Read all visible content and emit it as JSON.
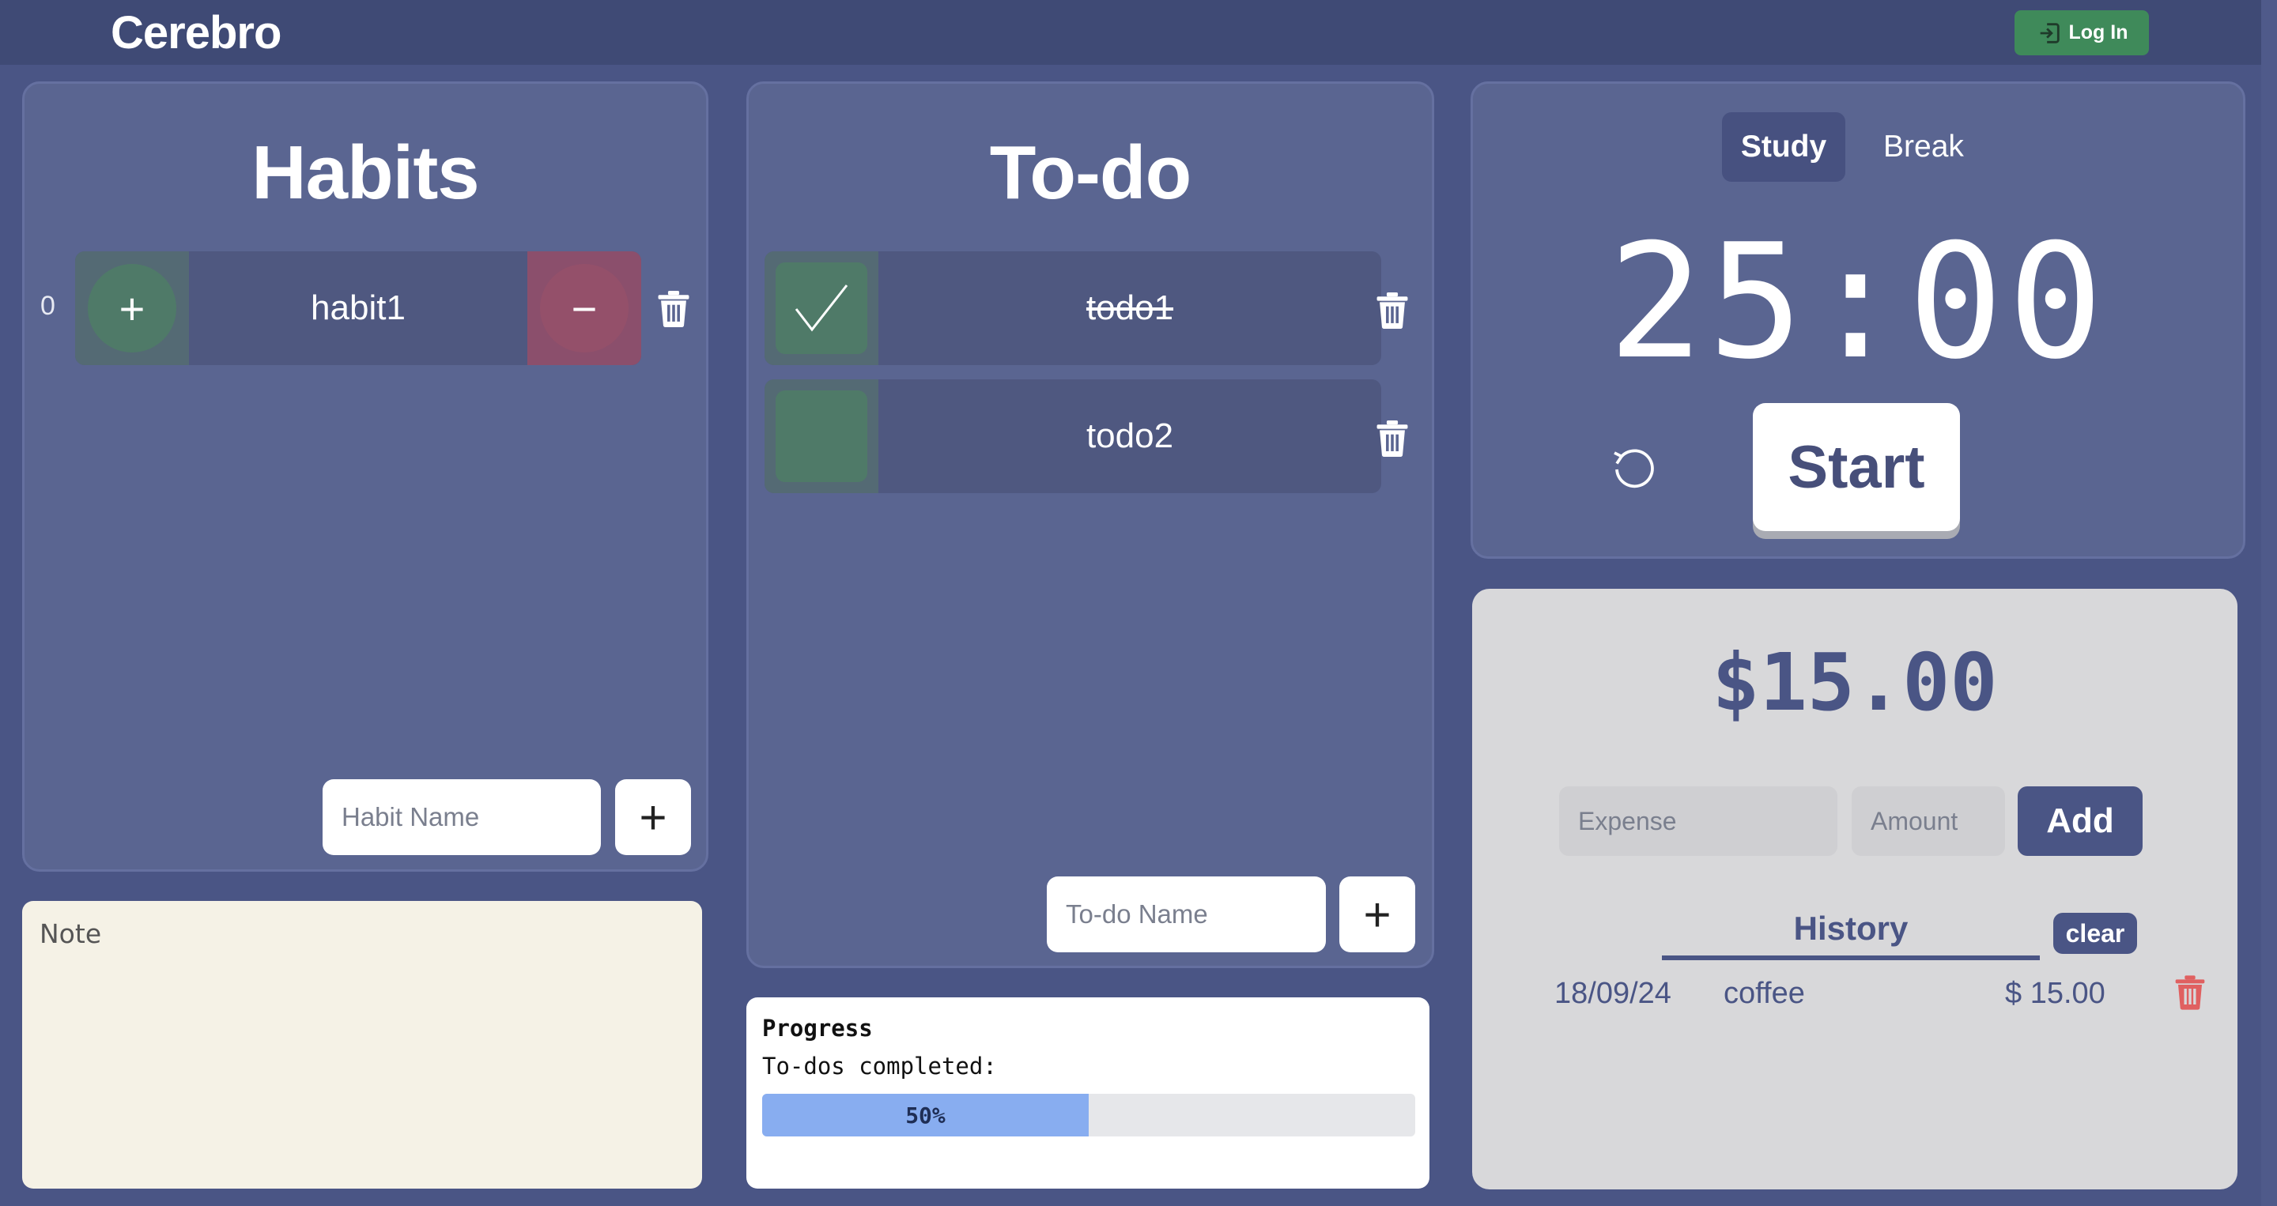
{
  "app": {
    "title": "Cerebro",
    "login_label": "Log In"
  },
  "colors": {
    "background": "#4a5585",
    "panel": "#5a6591",
    "login_green": "#3f8a5a",
    "note_bg": "#f5f2e6",
    "progress_fill": "#88adf0",
    "trash_red": "#e06060"
  },
  "habits": {
    "title": "Habits",
    "items": [
      {
        "count": "0",
        "name": "habit1",
        "plus_label": "+",
        "minus_label": "−"
      }
    ],
    "input_placeholder": "Habit Name",
    "add_label": "+"
  },
  "note": {
    "placeholder": "Note"
  },
  "todo": {
    "title": "To-do",
    "items": [
      {
        "name": "todo1",
        "done": true
      },
      {
        "name": "todo2",
        "done": false
      }
    ],
    "input_placeholder": "To-do Name",
    "add_label": "+"
  },
  "progress": {
    "title": "Progress",
    "label": "To-dos completed:",
    "percent_text": "50%",
    "fraction": 0.5
  },
  "timer": {
    "tabs": [
      {
        "label": "Study",
        "active": true
      },
      {
        "label": "Break",
        "active": false
      }
    ],
    "display": "25:00",
    "start_label": "Start"
  },
  "expenses": {
    "balance": "$15.00",
    "expense_placeholder": "Expense",
    "amount_placeholder": "Amount",
    "add_label": "Add",
    "history_title": "History",
    "clear_label": "clear",
    "history": [
      {
        "date": "18/09/24",
        "name": "coffee",
        "amount": "$ 15.00"
      }
    ]
  }
}
